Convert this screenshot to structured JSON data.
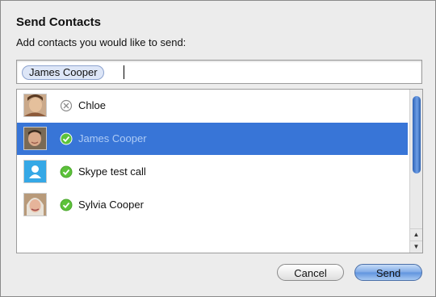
{
  "dialog": {
    "title": "Send Contacts",
    "subtitle": "Add contacts you would like to send:"
  },
  "token_field": {
    "tokens": [
      "James Cooper"
    ]
  },
  "contacts": [
    {
      "name": "Chloe",
      "status": "offline",
      "selected": false,
      "avatar": "photo-avatar"
    },
    {
      "name": "James Cooper",
      "status": "online",
      "selected": true,
      "avatar": "photo-avatar"
    },
    {
      "name": "Skype test call",
      "status": "online",
      "selected": false,
      "avatar": "default-person-avatar"
    },
    {
      "name": "Sylvia Cooper",
      "status": "online",
      "selected": false,
      "avatar": "photo-avatar"
    }
  ],
  "buttons": {
    "cancel": "Cancel",
    "send": "Send"
  },
  "colors": {
    "selection": "#3875d7",
    "online_status": "#5cc23a",
    "offline_status": "#8c8c8c"
  }
}
